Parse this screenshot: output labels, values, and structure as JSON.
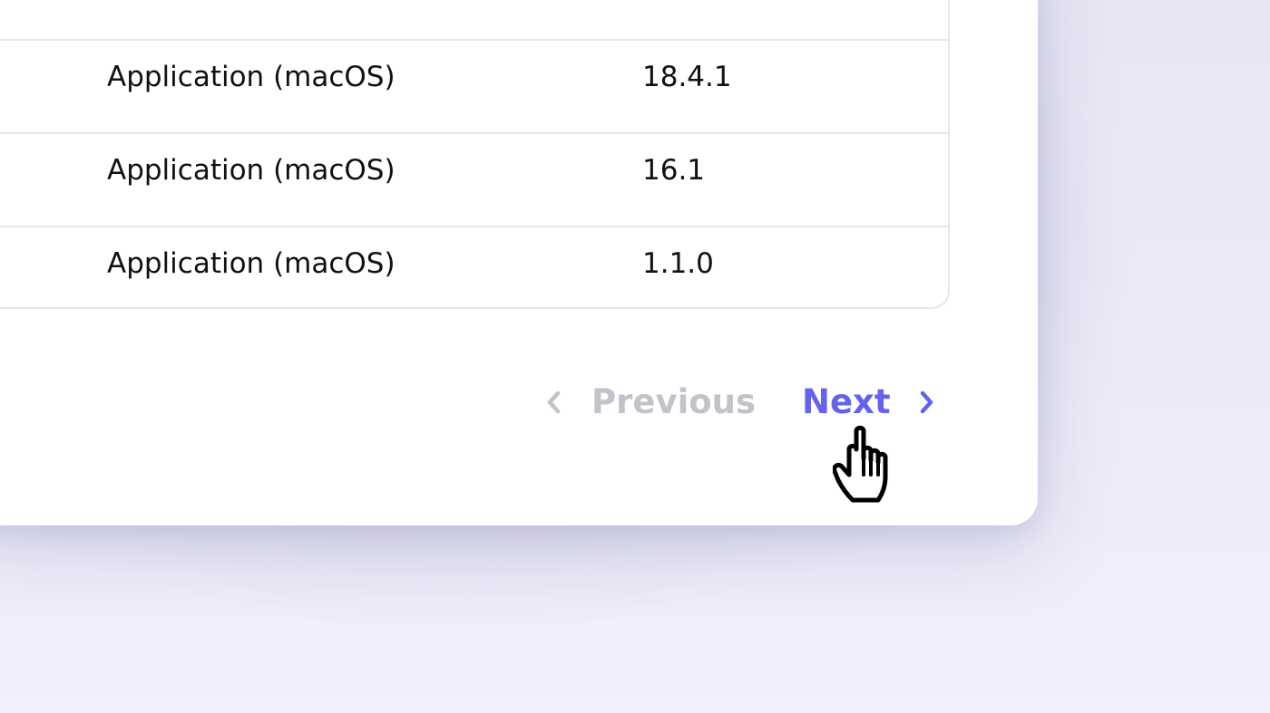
{
  "table": {
    "rows": [
      {
        "type": "Application (macOS)",
        "version": "18.4.1"
      },
      {
        "type": "Application (macOS)",
        "version": "16.1"
      },
      {
        "type": "Application (macOS)",
        "version": "1.1.0"
      }
    ]
  },
  "pagination": {
    "previous_label": "Previous",
    "next_label": "Next",
    "previous_icon": "chevron-left-icon",
    "next_icon": "chevron-right-icon"
  },
  "colors": {
    "accent": "#6563ec",
    "disabled": "#c2c2ca",
    "background": "#ecebf8"
  }
}
